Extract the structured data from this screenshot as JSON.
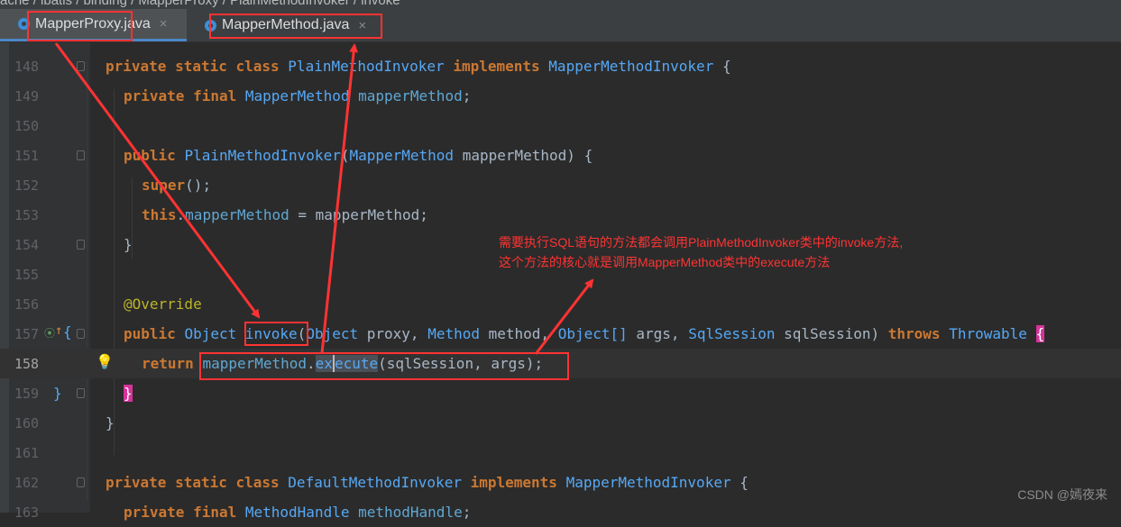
{
  "breadcrumb": "ache  /  ibatis  /  binding  /  MapperProxy  /  PlainMethodInvoker  /  invoke",
  "tabs": [
    {
      "label": "MapperProxy.java",
      "close": "×"
    },
    {
      "label": "MapperMethod.java",
      "close": "×"
    }
  ],
  "editor": {
    "current_line": "158",
    "lines": [
      {
        "no": "148"
      },
      {
        "no": "149"
      },
      {
        "no": "150"
      },
      {
        "no": "151"
      },
      {
        "no": "152"
      },
      {
        "no": "153"
      },
      {
        "no": "154"
      },
      {
        "no": "155"
      },
      {
        "no": "156"
      },
      {
        "no": "157"
      },
      {
        "no": "158"
      },
      {
        "no": "159"
      },
      {
        "no": "160"
      },
      {
        "no": "161"
      },
      {
        "no": "162"
      },
      {
        "no": "163"
      }
    ],
    "code": {
      "l148": {
        "kw": "private static class",
        "name": "PlainMethodInvoker",
        "impl": "implements",
        "iface": "MapperMethodInvoker",
        "brace": "{"
      },
      "l149": {
        "kw": "private final",
        "type": "MapperMethod",
        "field": "mapperMethod",
        "semi": ";"
      },
      "l151": {
        "kw": "public",
        "name": "PlainMethodInvoker",
        "open": "(",
        "ptype": "MapperMethod",
        "param": "mapperMethod",
        "close": ") {"
      },
      "l152": {
        "kw": "super",
        "rest": "();"
      },
      "l153": {
        "kw": "this",
        "dot": ".",
        "field": "mapperMethod",
        "rest": " = mapperMethod;"
      },
      "l154": {
        "brace": "}"
      },
      "l156": {
        "ann": "@Override"
      },
      "l157": {
        "kw": "public",
        "type": "Object",
        "method": "invoke",
        "open": "(",
        "t1": "Object",
        "p1": "proxy",
        "t2": "Method",
        "p2": "method",
        "t3": "Object[]",
        "p3": "args",
        "t4": "SqlSession",
        "p4": "sqlSession",
        "close": ")",
        "throws": "throws",
        "ex": "Throwable",
        "brace": "{"
      },
      "l158": {
        "kw": "return",
        "field": "mapperMethod",
        "dot": ".",
        "call_a": "ex",
        "call_b": "ecute",
        "rest": "(sqlSession, args);"
      },
      "l159": {
        "brace": "}",
        "inner": "}"
      },
      "l160": {
        "brace": "}"
      },
      "l162": {
        "kw": "private static class",
        "name": "DefaultMethodInvoker",
        "impl": "implements",
        "iface": "MapperMethodInvoker",
        "brace": "{"
      },
      "l163": {
        "kw": "private final",
        "type": "MethodHandle",
        "field": "methodHandle",
        "semi": ";"
      }
    }
  },
  "annotation": {
    "line1": "需要执行SQL语句的方法都会调用PlainMethodInvoker类中的invoke方法,",
    "line2": "这个方法的核心就是调用MapperMethod类中的execute方法"
  },
  "watermark": "CSDN @嫣夜来",
  "colors": {
    "keyword": "#cc7832",
    "class": "#56a8f5",
    "field": "#5fa8d3",
    "annotation_red": "#ff3333",
    "brace_highlight": "#d6339a"
  }
}
